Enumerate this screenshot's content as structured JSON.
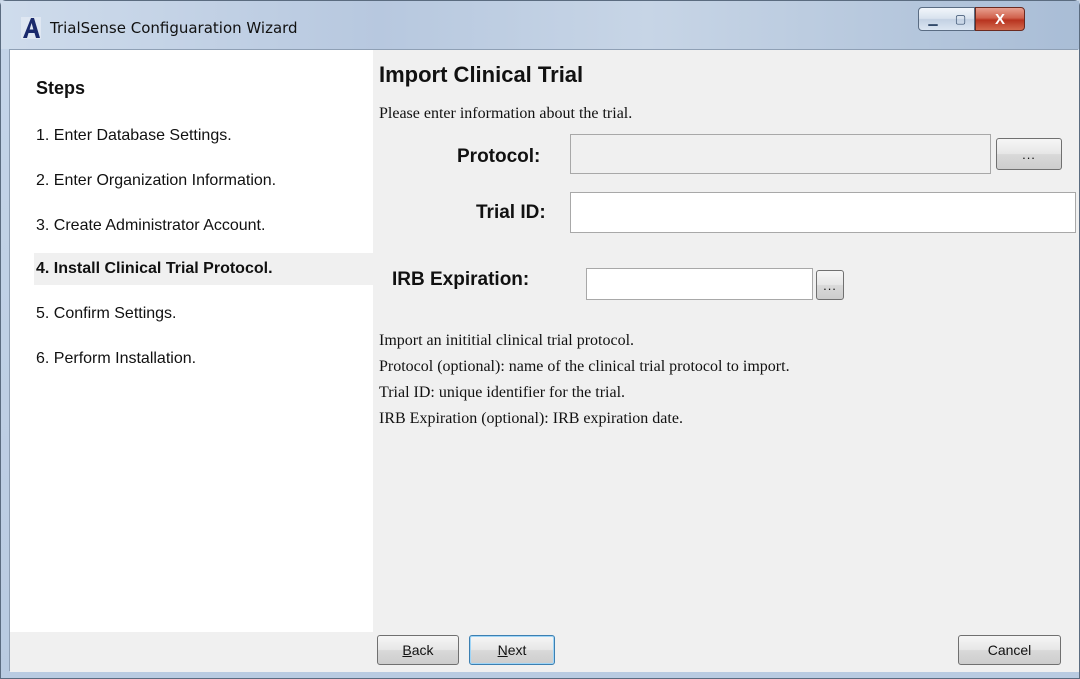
{
  "window": {
    "title": "TrialSense Configuaration Wizard",
    "controls": {
      "minimize": "▁",
      "maximize": "▢",
      "close": "X"
    }
  },
  "sidebar": {
    "title": "Steps",
    "items": [
      {
        "label": "1. Enter Database Settings."
      },
      {
        "label": "2. Enter Organization Information."
      },
      {
        "label": "3. Create Administrator Account."
      },
      {
        "label": "4. Install Clinical Trial Protocol.",
        "active": true
      },
      {
        "label": "5. Confirm Settings."
      },
      {
        "label": "6. Perform Installation."
      }
    ]
  },
  "main": {
    "title": "Import Clinical Trial",
    "intro": "Please enter information about the trial.",
    "protocol": {
      "label": "Protocol:",
      "value": "",
      "browse": "..."
    },
    "trial_id": {
      "label": "Trial ID:",
      "value": ""
    },
    "irb": {
      "label": "IRB Expiration:",
      "value": "",
      "browse": "..."
    },
    "help": [
      "Import an inititial clinical trial protocol.",
      "Protocol (optional): name of the clinical trial protocol to import.",
      "Trial ID: unique identifier for the trial.",
      "IRB Expiration (optional): IRB expiration date."
    ]
  },
  "footer": {
    "back": {
      "first": "B",
      "rest": "ack"
    },
    "next": {
      "first": "N",
      "rest": "ext"
    },
    "cancel": "Cancel"
  },
  "colors": {
    "title_bar": "#b7c8df",
    "close_button": "#c7432c",
    "panel_bg": "#f0f0f0"
  }
}
